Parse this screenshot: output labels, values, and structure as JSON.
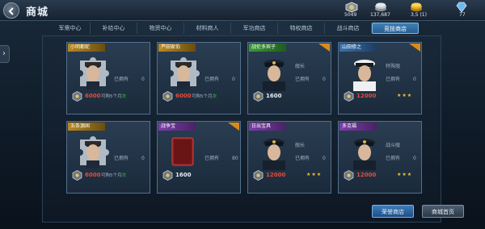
{
  "header": {
    "title": "商城",
    "resources": [
      {
        "icon": "medal-icon",
        "value": "5049"
      },
      {
        "icon": "coins-icon",
        "value": "137,687"
      },
      {
        "icon": "gold-icon",
        "value": "3,5 (1)"
      },
      {
        "icon": "diamond-icon",
        "value": "77"
      }
    ]
  },
  "tabs": [
    {
      "label": "军需中心",
      "active": false
    },
    {
      "label": "补给中心",
      "active": false
    },
    {
      "label": "物资中心",
      "active": false
    },
    {
      "label": "材料商人",
      "active": false
    },
    {
      "label": "军功商店",
      "active": false
    },
    {
      "label": "特权商店",
      "active": false
    },
    {
      "label": "战斗商店",
      "active": false
    },
    {
      "label": "竞技商店",
      "active": true
    }
  ],
  "cards": [
    {
      "ribbon": "小明都蛇",
      "ribbon_color": "gold",
      "corner": false,
      "portrait": "officer-puzzle-1",
      "info": [
        "",
        "已拥有",
        "0"
      ],
      "price": "6000",
      "price_color": "red",
      "note": "可购5个月",
      "note_hl": "次",
      "stars": ""
    },
    {
      "ribbon": "芦田家伯",
      "ribbon_color": "gold",
      "corner": false,
      "portrait": "officer-puzzle-2",
      "info": [
        "",
        "已拥有",
        "0"
      ],
      "price": "6000",
      "price_color": "red",
      "note": "可购5个月",
      "note_hl": "次",
      "stars": ""
    },
    {
      "ribbon": "战伦多宾子",
      "ribbon_color": "green",
      "corner": true,
      "portrait": "officer-captain",
      "info": [
        "舰长",
        "已拥有",
        "0"
      ],
      "price": "1600",
      "price_color": "white",
      "note": "",
      "note_hl": "",
      "stars": ""
    },
    {
      "ribbon": "山田修之",
      "ribbon_color": "blue",
      "corner": true,
      "portrait": "officer-white-cap",
      "info": [
        "特殊舰",
        "已拥有",
        "0"
      ],
      "price": "12000",
      "price_color": "red",
      "note": "",
      "note_hl": "",
      "stars": "★★★"
    },
    {
      "ribbon": "五条源国",
      "ribbon_color": "gold",
      "corner": false,
      "portrait": "officer-puzzle-3",
      "info": [
        "",
        "已拥有",
        "0"
      ],
      "price": "6000",
      "price_color": "red",
      "note": "可购5个月",
      "note_hl": "次",
      "stars": ""
    },
    {
      "ribbon": "战争宝",
      "ribbon_color": "purple",
      "corner": true,
      "portrait": "red-book",
      "info": [
        "",
        "已拥有",
        "80"
      ],
      "price": "1600",
      "price_color": "white",
      "note": "",
      "note_hl": "",
      "stars": ""
    },
    {
      "ribbon": "日出宝具",
      "ribbon_color": "purple",
      "corner": false,
      "portrait": "officer-dark-cap",
      "info": [
        "舰长",
        "已拥有",
        "0"
      ],
      "price": "12000",
      "price_color": "red",
      "note": "",
      "note_hl": "",
      "stars": "★★★"
    },
    {
      "ribbon": "多克福",
      "ribbon_color": "purple",
      "corner": false,
      "portrait": "officer-dark-cap-2",
      "info": [
        "战斗舰",
        "已拥有",
        "0"
      ],
      "price": "12000",
      "price_color": "red",
      "note": "",
      "note_hl": "",
      "stars": "★★★"
    }
  ],
  "buttons": {
    "primary": "荣誉商店",
    "secondary": "商城首页"
  }
}
